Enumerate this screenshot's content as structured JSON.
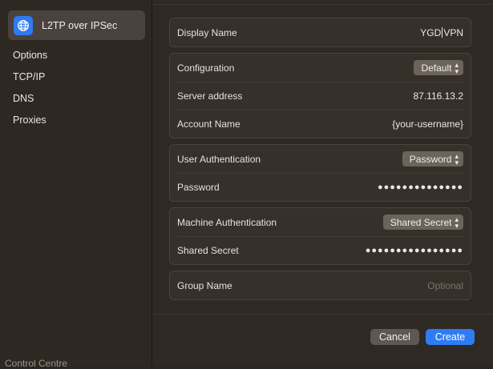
{
  "sidebar": {
    "selected": {
      "label": "L2TP over IPSec",
      "icon": "globe-network-icon"
    },
    "items": [
      {
        "label": "Options"
      },
      {
        "label": "TCP/IP"
      },
      {
        "label": "DNS"
      },
      {
        "label": "Proxies"
      }
    ],
    "footer_hint": "Control Centre"
  },
  "form": {
    "display_name": {
      "label": "Display Name",
      "value_before_caret": "YGD",
      "value_after_caret": "VPN"
    },
    "configuration": {
      "label": "Configuration",
      "selected": "Default"
    },
    "server_address": {
      "label": "Server address",
      "value": "87.116.13.2"
    },
    "account_name": {
      "label": "Account Name",
      "value": "{your-username}"
    },
    "user_auth": {
      "label": "User Authentication",
      "selected": "Password"
    },
    "password": {
      "label": "Password",
      "masked": "●●●●●●●●●●●●●●"
    },
    "machine_auth": {
      "label": "Machine Authentication",
      "selected": "Shared Secret"
    },
    "shared_secret": {
      "label": "Shared Secret",
      "masked": "●●●●●●●●●●●●●●●●"
    },
    "group_name": {
      "label": "Group Name",
      "placeholder": "Optional"
    }
  },
  "buttons": {
    "cancel": "Cancel",
    "create": "Create"
  },
  "colors": {
    "accent": "#2d7cf4",
    "background": "#2f2924",
    "sidebar_selected": "#4a433d"
  }
}
